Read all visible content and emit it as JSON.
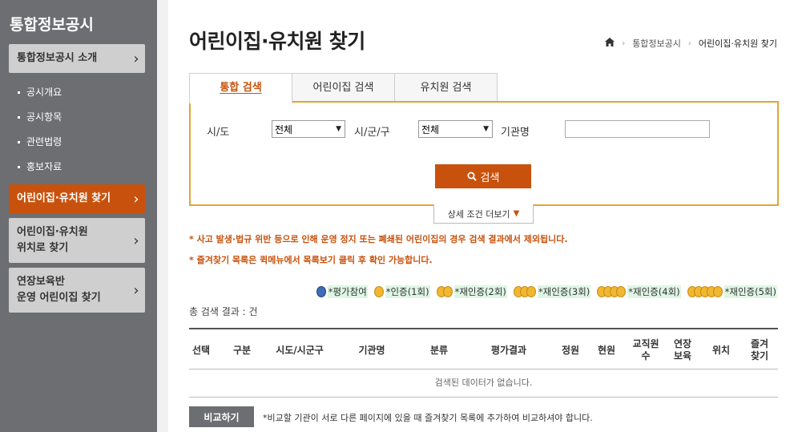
{
  "sidebar": {
    "title": "통합정보공시",
    "items": [
      {
        "label": "통합정보공시 소개"
      },
      {
        "label": "어린이집·유치원 찾기"
      },
      {
        "label": "어린이집·유치원\n위치로 찾기"
      },
      {
        "label": "연장보육반\n운영 어린이집 찾기"
      }
    ],
    "subitems": [
      "공시개요",
      "공시항목",
      "관련법령",
      "홍보자료"
    ]
  },
  "page": {
    "title": "어린이집·유치원 찾기",
    "breadcrumb": [
      "통합정보공시",
      "어린이집·유치원 찾기"
    ]
  },
  "tabs": [
    "통합 검색",
    "어린이집 검색",
    "유치원 검색"
  ],
  "search": {
    "sido_label": "시/도",
    "sido_value": "전체",
    "sigungu_label": "시/군/구",
    "sigungu_value": "전체",
    "org_label": "기관명",
    "org_value": "",
    "button_label": "검색",
    "more_label": "상세 조건 더보기"
  },
  "notices": [
    "* 사고 발생·법규 위반 등으로 인해 운영 정지 또는 폐쇄된 어린이집의 경우 검색 결과에서 제외됩니다.",
    "* 즐겨찾기 목록은 퀵메뉴에서 목록보기 클릭 후 확인 가능합니다."
  ],
  "legend": [
    "*평가참여",
    "*인증(1회)",
    "*재인증(2회)",
    "*재인증(3회)",
    "*재인증(4회)",
    "*재인증(5회)"
  ],
  "results": {
    "total_text": "총 검색 결과 : 건",
    "headers": [
      "선택",
      "구분",
      "시도/시군구",
      "기관명",
      "분류",
      "평가결과",
      "정원",
      "현원",
      "교직원\n수",
      "연장\n보육",
      "위치",
      "즐겨\n찾기"
    ],
    "empty_text": "검색된 데이터가 없습니다."
  },
  "compare": {
    "button_label": "비교하기",
    "note": "*비교할 기관이 서로 다른 페이지에 있을 때 즐겨찾기 목록에 추가하여 비교하셔야 합니다."
  },
  "colors": {
    "accent": "#c8520d",
    "sidebar_bg": "#6d6e72",
    "search_border": "#e3a534"
  }
}
